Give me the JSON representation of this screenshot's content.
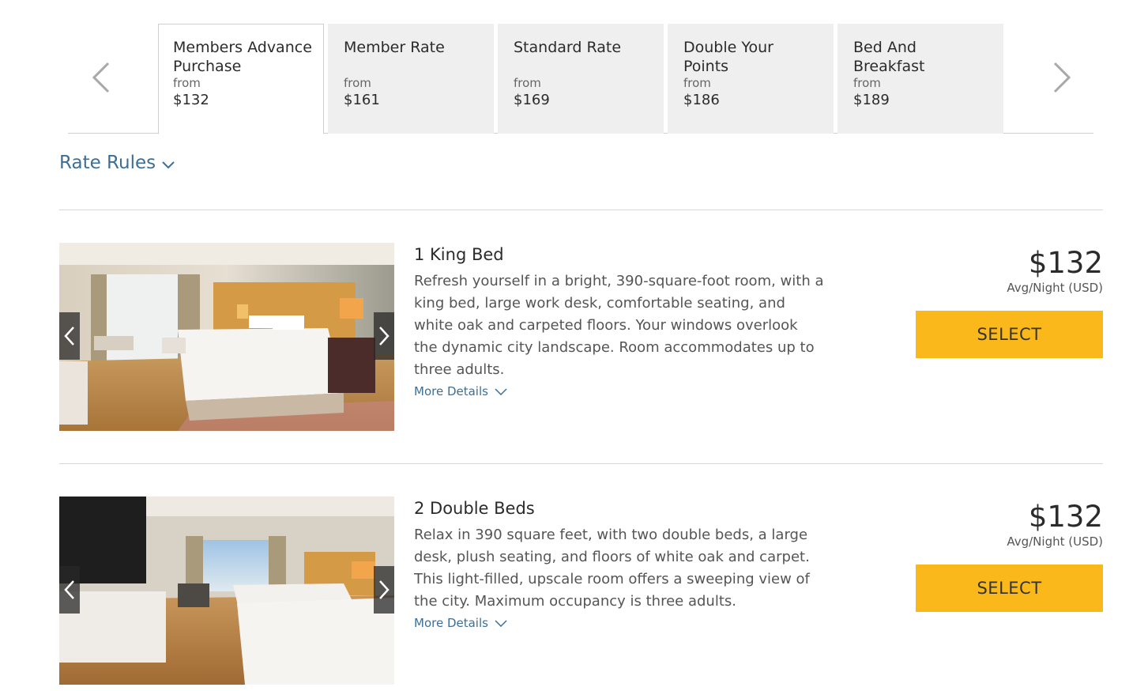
{
  "rate_tabs": [
    {
      "name": "Members Advance Purchase",
      "from_label": "from",
      "price": "$132",
      "active": true
    },
    {
      "name": "Member Rate",
      "from_label": "from",
      "price": "$161",
      "active": false
    },
    {
      "name": "Standard Rate",
      "from_label": "from",
      "price": "$169",
      "active": false
    },
    {
      "name": "Double Your Points",
      "from_label": "from",
      "price": "$186",
      "active": false
    },
    {
      "name": "Bed And Breakfast",
      "from_label": "from",
      "price": "$189",
      "active": false
    }
  ],
  "icons": {
    "prev": "chevron-left-icon",
    "next": "chevron-right-icon",
    "expand": "chevron-down-icon"
  },
  "rate_rules": {
    "label": "Rate Rules"
  },
  "rooms": [
    {
      "title": "1 King Bed",
      "description": "Refresh yourself in a bright, 390-square-foot room, with a king bed, large work desk, comfortable seating, and white oak and carpeted floors. Your windows overlook the dynamic city landscape. Room accommodates up to three adults.",
      "more_details": "More Details",
      "price": "$132",
      "price_unit": "Avg/Night (USD)",
      "select_label": "SELECT"
    },
    {
      "title": "2 Double Beds",
      "description": "Relax in 390 square feet, with two double beds, a large desk, plush seating, and floors of white oak and carpet. This light-filled, upscale room offers a sweeping view of the city. Maximum occupancy is three adults.",
      "more_details": "More Details",
      "price": "$132",
      "price_unit": "Avg/Night (USD)",
      "select_label": "SELECT"
    }
  ],
  "colors": {
    "accent_link": "#3d6f96",
    "select_button": "#fbb81b",
    "tab_inactive_bg": "#efefef"
  }
}
